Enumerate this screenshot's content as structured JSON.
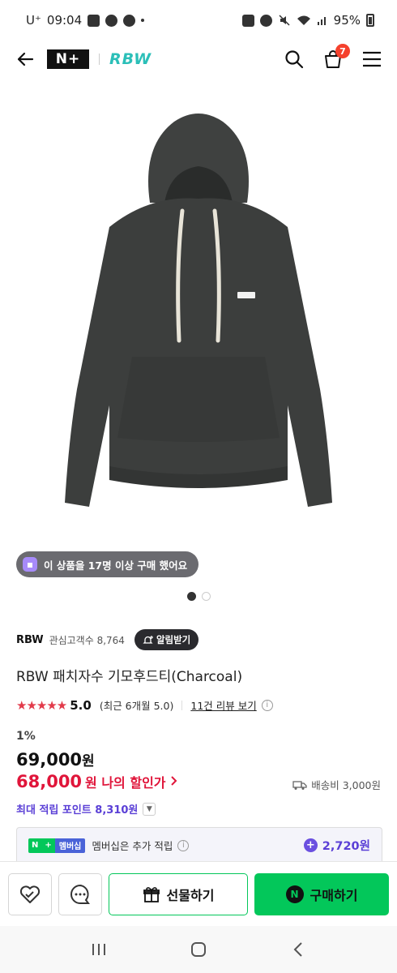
{
  "status": {
    "carrier": "U⁺",
    "time": "09:04",
    "battery": "95%"
  },
  "header": {
    "logo_text": "N+",
    "brand": "RBW",
    "cart_count": "7"
  },
  "image_pager": {
    "count": 2,
    "active": 0
  },
  "purchase_chip": "이 상품을 17명 이상 구매 했어요",
  "store": {
    "name": "RBW",
    "followers": "관심고객수 8,764",
    "follow_label": "알림받기"
  },
  "product": {
    "title": "RBW 패치자수 기모후드티(Charcoal)",
    "stars": "★★★★★",
    "rating": "5.0",
    "recent_rating": "(최근 6개월 5.0)",
    "review_link": "11건 리뷰 보기",
    "discount": "1%",
    "original_price": "69,000",
    "price_unit": "원",
    "my_price": "68,000",
    "my_price_label": "원 나의 할인가",
    "shipping": "배송비 3,000원",
    "max_points": "최대 적립 포인트 8,310원"
  },
  "membership": {
    "badge_n": "N",
    "badge_plus": "+",
    "badge_text": "멤버십",
    "text": "멤버십은 추가 적립",
    "points": "2,720원"
  },
  "actions": {
    "gift_label": "선물하기",
    "buy_label": "구매하기",
    "npay_letter": "N"
  },
  "colors": {
    "naver_green": "#03c75a",
    "price_red": "#e0153a",
    "points_purple": "#5a3fd6"
  }
}
